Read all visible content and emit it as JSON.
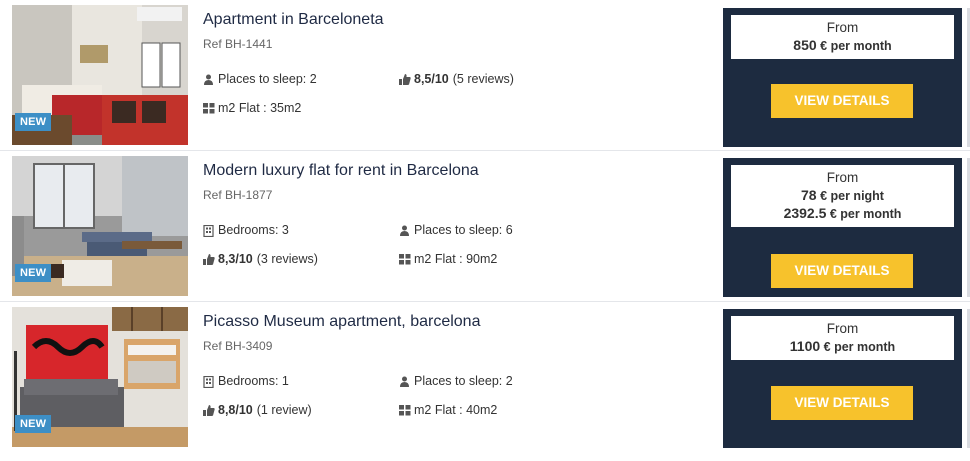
{
  "listings": [
    {
      "image_alt": "Apartment bedroom with red sofa",
      "badge": "NEW",
      "title": "Apartment in Barceloneta",
      "ref": "Ref BH-1441",
      "attrs": {
        "sleep": "Places to sleep: 2",
        "rating_score": "8,5/10",
        "rating_reviews": "(5 reviews)",
        "m2": "m2 Flat : 35m2"
      },
      "price": {
        "from": "From",
        "lines": [
          {
            "amount": "850",
            "unit": "€ per month"
          }
        ]
      },
      "cta": "VIEW DETAILS"
    },
    {
      "image_alt": "Modern living room with tall windows",
      "badge": "NEW",
      "title": "Modern luxury flat for rent in Barcelona",
      "ref": "Ref BH-1877",
      "attrs": {
        "bedrooms": "Bedrooms: 3",
        "sleep": "Places to sleep: 6",
        "rating_score": "8,3/10",
        "rating_reviews": "(3 reviews)",
        "m2": "m2 Flat : 90m2"
      },
      "price": {
        "from": "From",
        "lines": [
          {
            "amount": "78",
            "unit": "€ per night"
          },
          {
            "amount": "2392.5",
            "unit": "€ per month"
          }
        ]
      },
      "cta": "VIEW DETAILS"
    },
    {
      "image_alt": "Living room with red artwork and grey sofa",
      "badge": "NEW",
      "title": "Picasso Museum apartment, barcelona",
      "ref": "Ref BH-3409",
      "attrs": {
        "bedrooms": "Bedrooms: 1",
        "sleep": "Places to sleep: 2",
        "rating_score": "8,8/10",
        "rating_reviews": "(1 review)",
        "m2": "m2 Flat : 40m2"
      },
      "price": {
        "from": "From",
        "lines": [
          {
            "amount": "1100",
            "unit": "€ per month"
          }
        ]
      },
      "cta": "VIEW DETAILS"
    }
  ],
  "icons": {
    "person": "person-icon",
    "thumb": "thumbs-up-icon",
    "grid": "grid-icon",
    "building": "building-icon"
  },
  "colors": {
    "panel": "#1d2b40",
    "button": "#f7c22c",
    "badge": "#3d8fc6",
    "title": "#1f2a44"
  }
}
